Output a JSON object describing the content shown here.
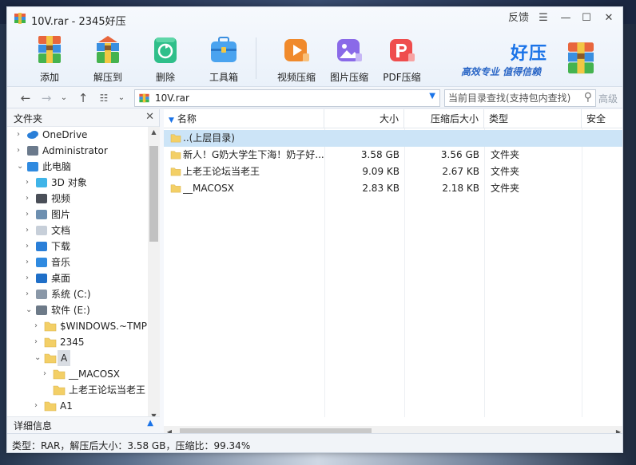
{
  "window": {
    "title": "10V.rar - 2345好压",
    "feedback": "反馈"
  },
  "toolbar": {
    "buttons": [
      {
        "label": "添加",
        "icon": "add-archive-icon"
      },
      {
        "label": "解压到",
        "icon": "extract-icon"
      },
      {
        "label": "删除",
        "icon": "delete-recycle-icon"
      },
      {
        "label": "工具箱",
        "icon": "toolbox-icon"
      },
      {
        "label": "视频压缩",
        "icon": "video-compress-icon"
      },
      {
        "label": "图片压缩",
        "icon": "image-compress-icon"
      },
      {
        "label": "PDF压缩",
        "icon": "pdf-compress-icon"
      }
    ]
  },
  "brand": {
    "name": "好压",
    "slogan": "高效专业 值得信赖"
  },
  "address": {
    "path": "10V.rar",
    "search_placeholder": "当前目录查找(支持包内查找)",
    "advanced": "高级"
  },
  "folder_panel": {
    "title": "文件夹",
    "tree": [
      {
        "label": "OneDrive",
        "icon": "onedrive-icon",
        "arrow": "›",
        "depth": 0
      },
      {
        "label": "Administrator",
        "icon": "user-icon",
        "arrow": "›",
        "depth": 0
      },
      {
        "label": "此电脑",
        "icon": "computer-icon",
        "arrow": "⌄",
        "depth": 0
      },
      {
        "label": "3D 对象",
        "icon": "3d-objects-icon",
        "arrow": "›",
        "depth": 1
      },
      {
        "label": "视频",
        "icon": "video-folder-icon",
        "arrow": "›",
        "depth": 1
      },
      {
        "label": "图片",
        "icon": "pictures-folder-icon",
        "arrow": "›",
        "depth": 1
      },
      {
        "label": "文档",
        "icon": "documents-folder-icon",
        "arrow": "›",
        "depth": 1
      },
      {
        "label": "下载",
        "icon": "download-folder-icon",
        "arrow": "›",
        "depth": 1
      },
      {
        "label": "音乐",
        "icon": "music-folder-icon",
        "arrow": "›",
        "depth": 1
      },
      {
        "label": "桌面",
        "icon": "desktop-folder-icon",
        "arrow": "›",
        "depth": 1
      },
      {
        "label": "系统 (C:)",
        "icon": "drive-c-icon",
        "arrow": "›",
        "depth": 1
      },
      {
        "label": "软件 (E:)",
        "icon": "drive-e-icon",
        "arrow": "⌄",
        "depth": 1
      },
      {
        "label": "$WINDOWS.~TMP",
        "icon": "folder-icon",
        "arrow": "›",
        "depth": 2
      },
      {
        "label": "2345",
        "icon": "folder-icon",
        "arrow": "›",
        "depth": 2
      },
      {
        "label": "A",
        "icon": "folder-icon",
        "arrow": "⌄",
        "depth": 2,
        "selected": true
      },
      {
        "label": "__MACOSX",
        "icon": "folder-icon",
        "arrow": "›",
        "depth": 3
      },
      {
        "label": "上老王论坛当老王",
        "icon": "folder-icon",
        "arrow": "",
        "depth": 3
      },
      {
        "label": "A1",
        "icon": "folder-icon",
        "arrow": "›",
        "depth": 2
      }
    ],
    "detail_title": "详细信息"
  },
  "file_list": {
    "columns": [
      "名称",
      "大小",
      "压缩后大小",
      "类型",
      "安全"
    ],
    "rows": [
      {
        "name": "..(上层目录)",
        "size": "",
        "packed": "",
        "type": "",
        "highlight": true
      },
      {
        "name": "新人！G奶大学生下海！奶子好...",
        "size": "3.58 GB",
        "packed": "3.56 GB",
        "type": "文件夹"
      },
      {
        "name": "上老王论坛当老王",
        "size": "9.09 KB",
        "packed": "2.67 KB",
        "type": "文件夹"
      },
      {
        "name": "__MACOSX",
        "size": "2.83 KB",
        "packed": "2.18 KB",
        "type": "文件夹"
      }
    ]
  },
  "status": {
    "text": "类型：RAR，解压后大小：3.58 GB，压缩比：99.34%"
  }
}
